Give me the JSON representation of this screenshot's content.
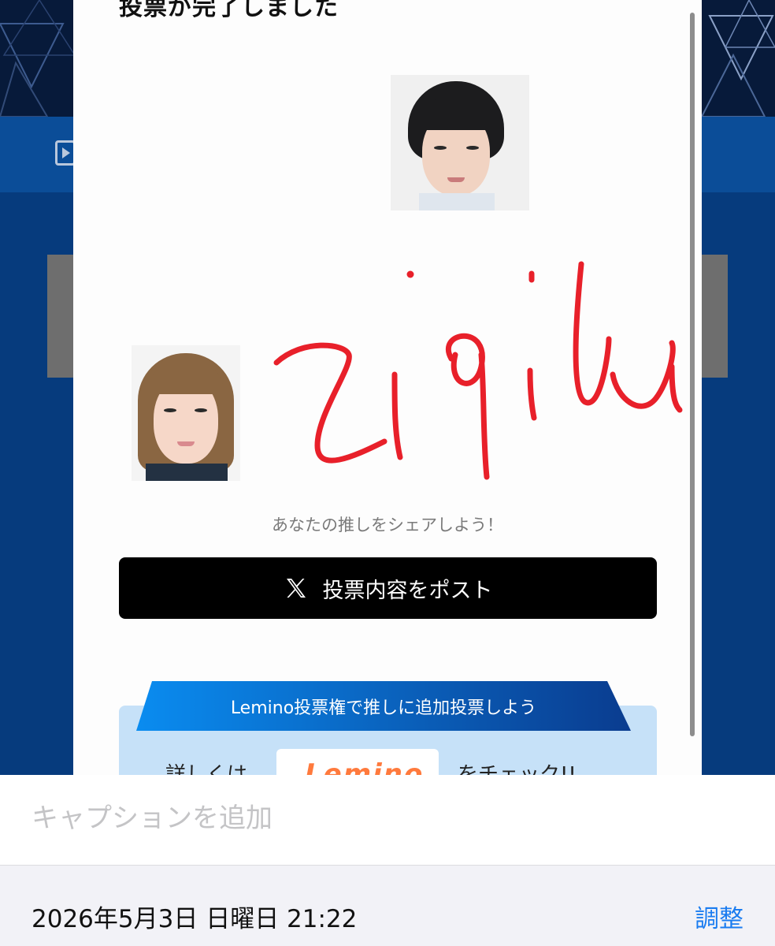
{
  "modal": {
    "title": "投票が完了しました",
    "share_hint": "あなたの推しをシェアしよう！",
    "post_button_label": "投票内容をポスト"
  },
  "lemino": {
    "banner_text": "Lemino投票権で推しに追加投票しよう",
    "detail_prefix": "詳しくは",
    "logo_text": "Lemino",
    "detail_suffix": "をチェック!!"
  },
  "caption": {
    "placeholder": "キャプションを追加",
    "value": ""
  },
  "photo_info": {
    "datetime": "2026年5月3日 日曜日 21:22",
    "adjust_label": "調整"
  },
  "colors": {
    "post_button": "#000000",
    "scribble": "#e8202a",
    "accent_blue": "#1a7cf0",
    "banner_blue": "#0a6fd8"
  },
  "icons": [
    "x-logo-icon",
    "play-icon"
  ]
}
